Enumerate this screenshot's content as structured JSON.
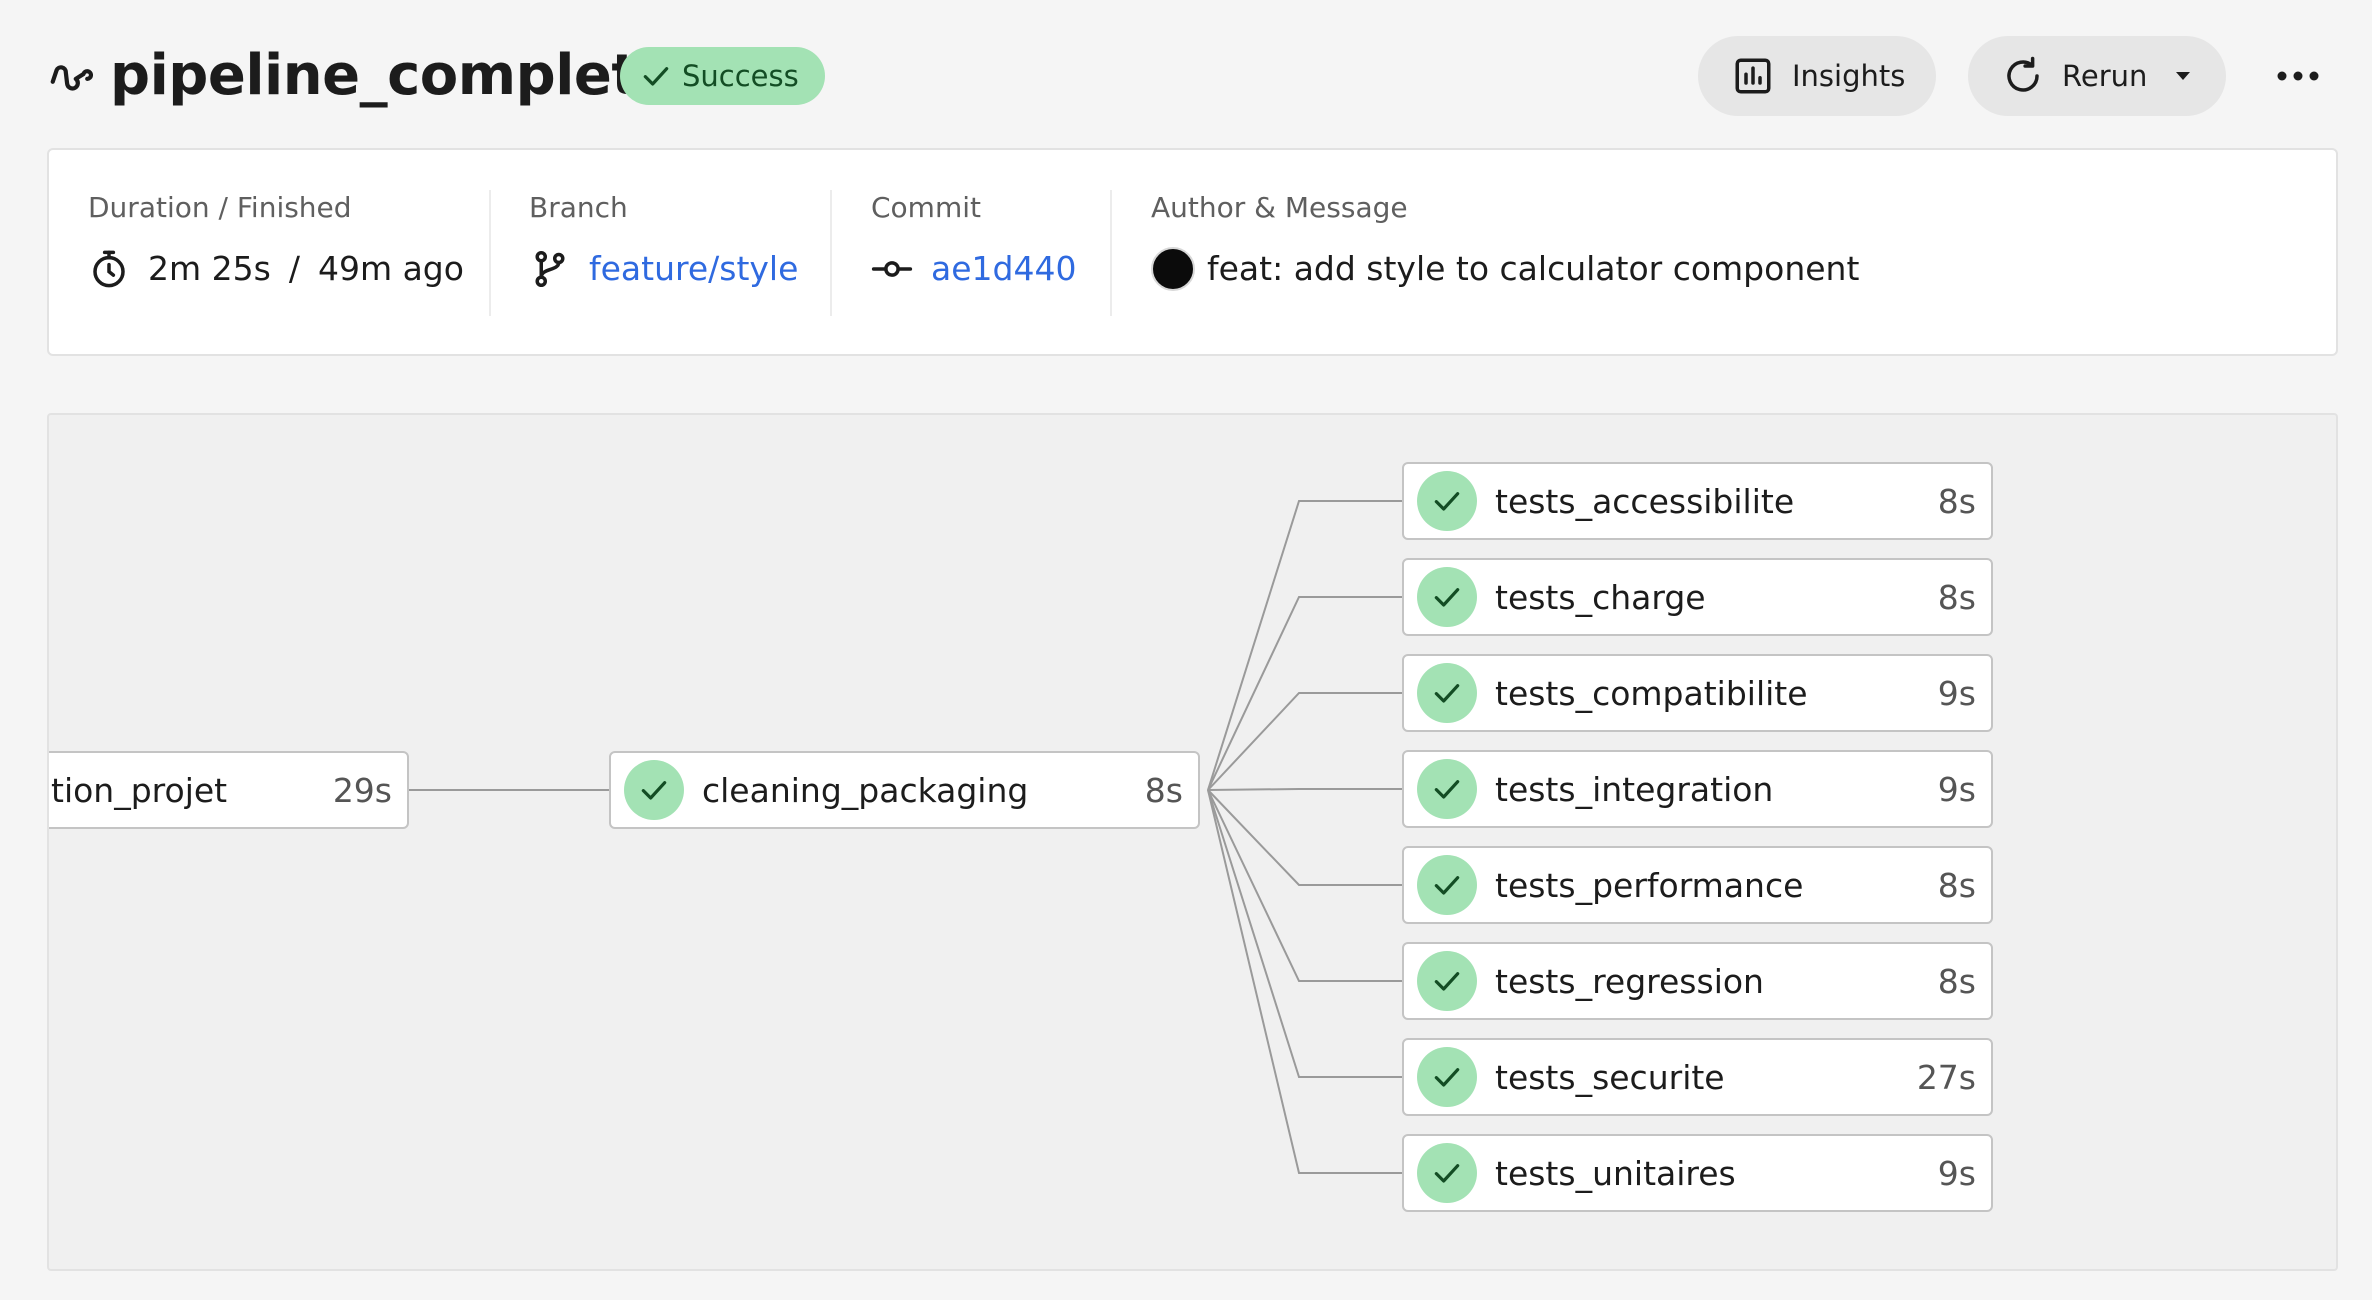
{
  "header": {
    "title": "pipeline_complete",
    "status": "Success",
    "insights_label": "Insights",
    "rerun_label": "Rerun"
  },
  "info": {
    "duration_label": "Duration / Finished",
    "duration": "2m 25s",
    "separator": "/",
    "finished": "49m ago",
    "branch_label": "Branch",
    "branch": "feature/style",
    "commit_label": "Commit",
    "commit": "ae1d440",
    "author_label": "Author & Message",
    "message": "feat: add style to calculator component"
  },
  "graph": {
    "first_job": {
      "name": "tion_projet",
      "duration": "29s"
    },
    "middle_job": {
      "name": "cleaning_packaging",
      "duration": "8s",
      "status": "success"
    },
    "test_jobs": [
      {
        "name": "tests_accessibilite",
        "duration": "8s",
        "status": "success"
      },
      {
        "name": "tests_charge",
        "duration": "8s",
        "status": "success"
      },
      {
        "name": "tests_compatibilite",
        "duration": "9s",
        "status": "success"
      },
      {
        "name": "tests_integration",
        "duration": "9s",
        "status": "success"
      },
      {
        "name": "tests_performance",
        "duration": "8s",
        "status": "success"
      },
      {
        "name": "tests_regression",
        "duration": "8s",
        "status": "success"
      },
      {
        "name": "tests_securite",
        "duration": "27s",
        "status": "success"
      },
      {
        "name": "tests_unitaires",
        "duration": "9s",
        "status": "success"
      }
    ]
  },
  "colors": {
    "success_bg": "#a3e2b4",
    "success_fg": "#134d24",
    "link": "#2f6ae0"
  },
  "icons": {
    "workflow": "workflow-icon",
    "check": "check-icon",
    "insights": "bar-chart-icon",
    "rerun": "refresh-icon",
    "caret": "caret-down-icon",
    "more": "more-horizontal-icon",
    "timer": "stopwatch-icon",
    "branch": "git-branch-icon",
    "commit": "git-commit-icon"
  }
}
